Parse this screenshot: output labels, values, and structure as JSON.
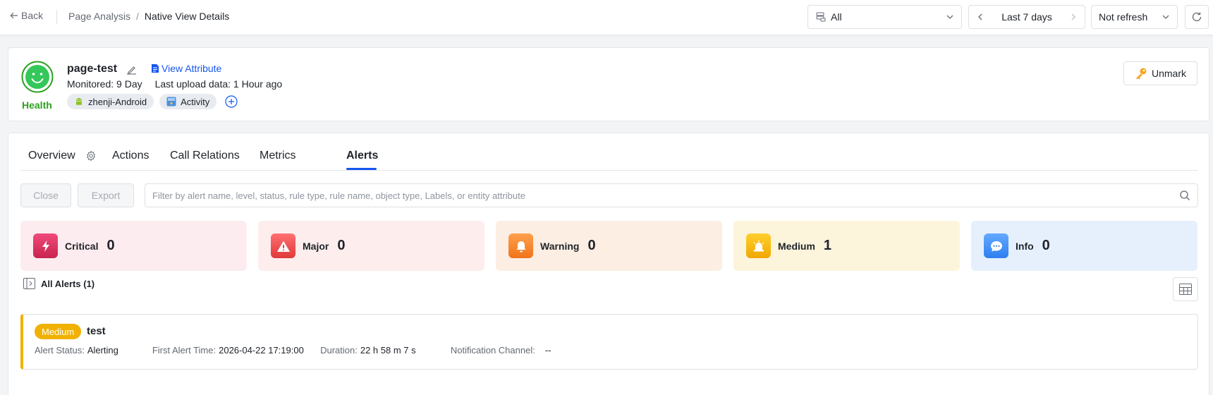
{
  "topbar": {
    "back_label": "Back",
    "crumb_parent": "Page Analysis",
    "crumb_sep": "/",
    "crumb_current": "Native View Details",
    "env_select": "All",
    "time_range": "Last 7 days",
    "refresh_select": "Not refresh"
  },
  "header": {
    "health_label": "Health",
    "name": "page-test",
    "view_attribute": "View Attribute",
    "monitored": "Monitored: 9 Day",
    "last_upload": "Last upload data: 1 Hour ago",
    "tags": [
      {
        "label": "zhenji-Android",
        "icon": "android-icon"
      },
      {
        "label": "Activity",
        "icon": "activity-icon"
      }
    ],
    "unmark_label": "Unmark"
  },
  "tabs": [
    {
      "label": "Overview"
    },
    {
      "label": "Actions"
    },
    {
      "label": "Call Relations"
    },
    {
      "label": "Metrics"
    },
    {
      "label": "Alerts",
      "active": true
    }
  ],
  "toolbar": {
    "close_label": "Close",
    "export_label": "Export",
    "filter_placeholder": "Filter by alert name, level, status, rule type, rule name, object type, Labels, or entity attribute"
  },
  "stats": [
    {
      "label": "Critical",
      "value": "0",
      "bg": "#fdecef",
      "icon_bg": "#d92b5c",
      "icon": "lightning-icon"
    },
    {
      "label": "Major",
      "value": "0",
      "bg": "#fdeded",
      "icon_bg": "#f04949",
      "icon": "warning-triangle-icon"
    },
    {
      "label": "Warning",
      "value": "0",
      "bg": "#fdeee3",
      "icon_bg": "#f5862d",
      "icon": "bell-icon"
    },
    {
      "label": "Medium",
      "value": "1",
      "bg": "#fdf4dc",
      "icon_bg": "#f5b50c",
      "icon": "alarm-light-icon"
    },
    {
      "label": "Info",
      "value": "0",
      "bg": "#e6f0fd",
      "icon_bg": "#3b8cf5",
      "icon": "chat-bubble-icon"
    }
  ],
  "list": {
    "title": "All Alerts",
    "count_open": "(",
    "count": "1",
    "count_close": ")"
  },
  "alert": {
    "level": "Medium",
    "name": "test",
    "status_key": "Alert Status:",
    "status_val": "Alerting",
    "first_time_key": "First Alert Time:",
    "first_time_val": "2026-04-22 17:19:00",
    "duration_key": "Duration:",
    "duration_val": "22 h 58 m 7 s",
    "channel_key": "Notification Channel:",
    "channel_val": "--"
  }
}
